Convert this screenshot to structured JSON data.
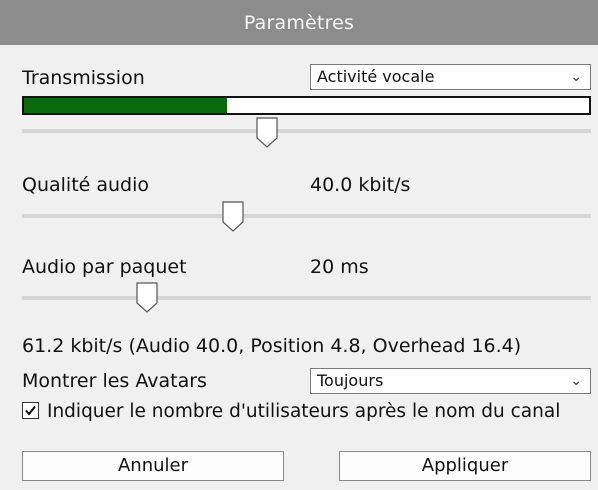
{
  "window": {
    "title": "Paramètres"
  },
  "transmission": {
    "label": "Transmission",
    "selected": "Activité vocale",
    "level": 0.36,
    "threshold": 0.43
  },
  "quality": {
    "label": "Qualité audio",
    "value": "40.0 kbit/s",
    "slider": 0.37
  },
  "packet": {
    "label": "Audio par paquet",
    "value": "20 ms",
    "slider": 0.22
  },
  "bitrate_summary": "61.2 kbit/s (Audio 40.0, Position 4.8, Overhead 16.4)",
  "avatars": {
    "label": "Montrer les Avatars",
    "selected": "Toujours"
  },
  "user_count": {
    "checked": true,
    "label": "Indiquer le nombre d'utilisateurs après le nom du canal"
  },
  "buttons": {
    "cancel": "Annuler",
    "apply": "Appliquer"
  },
  "colors": {
    "title_bar": "#8c8c8c",
    "meter_fill": "#0a6a0a"
  }
}
